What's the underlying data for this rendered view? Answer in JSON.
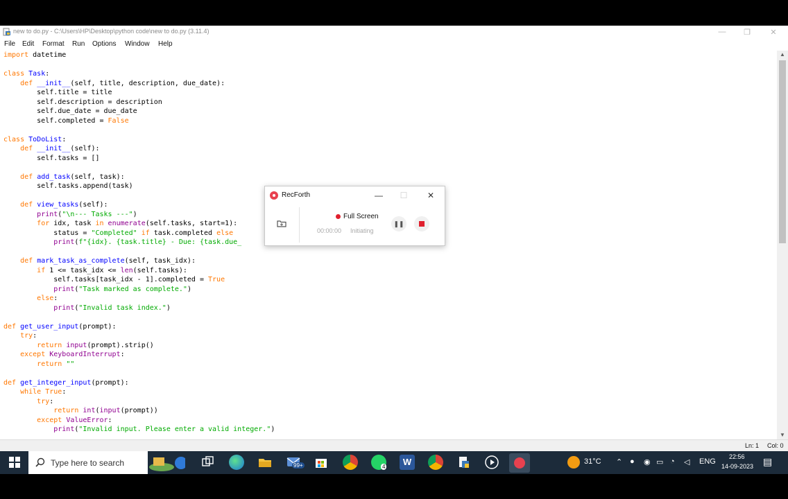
{
  "window": {
    "title": "new to do.py - C:\\Users\\HP\\Desktop\\python code\\new to do.py (3.11.4)",
    "minimize_glyph": "—",
    "maximize_glyph": "❐",
    "close_glyph": "✕"
  },
  "menu": {
    "items": [
      "File",
      "Edit",
      "Format",
      "Run",
      "Options",
      "Window",
      "Help"
    ]
  },
  "status": {
    "line": "Ln: 1",
    "col": "Col: 0"
  },
  "recorder": {
    "app_name": "RecForth",
    "mode": "Full Screen",
    "time": "00:00:00",
    "state": "Initiating",
    "pause_glyph": "❚❚",
    "minimize_glyph": "—",
    "maximize_glyph": "☐",
    "close_glyph": "✕"
  },
  "taskbar": {
    "search_placeholder": "Type here to search",
    "mail_badge": "99+",
    "whatsapp_badge": "4",
    "temperature": "31°C",
    "language": "ENG",
    "clock_time": "22:56",
    "clock_date": "14-09-2023"
  },
  "colors": {
    "keyword": "#ff7700",
    "definition": "#0000ff",
    "builtin": "#900090",
    "string": "#00aa00",
    "taskbar_bg": "#1c2b3a",
    "record_red": "#e0202e"
  },
  "code_lines": [
    [
      {
        "t": "import",
        "c": "kw"
      },
      {
        "t": " datetime"
      }
    ],
    [],
    [
      {
        "t": "class",
        "c": "kw"
      },
      {
        "t": " "
      },
      {
        "t": "Task",
        "c": "def"
      },
      {
        "t": ":"
      }
    ],
    [
      {
        "t": "    "
      },
      {
        "t": "def",
        "c": "kw"
      },
      {
        "t": " "
      },
      {
        "t": "__init__",
        "c": "def"
      },
      {
        "t": "(self, title, description, due_date):"
      }
    ],
    [
      {
        "t": "        self.title = title"
      }
    ],
    [
      {
        "t": "        self.description = description"
      }
    ],
    [
      {
        "t": "        self.due_date = due_date"
      }
    ],
    [
      {
        "t": "        self.completed = "
      },
      {
        "t": "False",
        "c": "kw"
      }
    ],
    [],
    [
      {
        "t": "class",
        "c": "kw"
      },
      {
        "t": " "
      },
      {
        "t": "ToDoList",
        "c": "def"
      },
      {
        "t": ":"
      }
    ],
    [
      {
        "t": "    "
      },
      {
        "t": "def",
        "c": "kw"
      },
      {
        "t": " "
      },
      {
        "t": "__init__",
        "c": "def"
      },
      {
        "t": "(self):"
      }
    ],
    [
      {
        "t": "        self.tasks = []"
      }
    ],
    [],
    [
      {
        "t": "    "
      },
      {
        "t": "def",
        "c": "kw"
      },
      {
        "t": " "
      },
      {
        "t": "add_task",
        "c": "def"
      },
      {
        "t": "(self, task):"
      }
    ],
    [
      {
        "t": "        self.tasks.append(task)"
      }
    ],
    [],
    [
      {
        "t": "    "
      },
      {
        "t": "def",
        "c": "kw"
      },
      {
        "t": " "
      },
      {
        "t": "view_tasks",
        "c": "def"
      },
      {
        "t": "(self):"
      }
    ],
    [
      {
        "t": "        "
      },
      {
        "t": "print",
        "c": "bi"
      },
      {
        "t": "("
      },
      {
        "t": "\"\\n--- Tasks ---\"",
        "c": "str"
      },
      {
        "t": ")"
      }
    ],
    [
      {
        "t": "        "
      },
      {
        "t": "for",
        "c": "kw"
      },
      {
        "t": " idx, task "
      },
      {
        "t": "in",
        "c": "kw"
      },
      {
        "t": " "
      },
      {
        "t": "enumerate",
        "c": "bi"
      },
      {
        "t": "(self.tasks, start=1):"
      }
    ],
    [
      {
        "t": "            status = "
      },
      {
        "t": "\"Completed\"",
        "c": "str"
      },
      {
        "t": " "
      },
      {
        "t": "if",
        "c": "kw"
      },
      {
        "t": " task.completed "
      },
      {
        "t": "else",
        "c": "kw"
      }
    ],
    [
      {
        "t": "            "
      },
      {
        "t": "print",
        "c": "bi"
      },
      {
        "t": "("
      },
      {
        "t": "f\"{idx}. {task.title} - Due: {task.due_",
        "c": "str"
      }
    ],
    [],
    [
      {
        "t": "    "
      },
      {
        "t": "def",
        "c": "kw"
      },
      {
        "t": " "
      },
      {
        "t": "mark_task_as_complete",
        "c": "def"
      },
      {
        "t": "(self, task_idx):"
      }
    ],
    [
      {
        "t": "        "
      },
      {
        "t": "if",
        "c": "kw"
      },
      {
        "t": " 1 <= task_idx <= "
      },
      {
        "t": "len",
        "c": "bi"
      },
      {
        "t": "(self.tasks):"
      }
    ],
    [
      {
        "t": "            self.tasks[task_idx - 1].completed = "
      },
      {
        "t": "True",
        "c": "kw"
      }
    ],
    [
      {
        "t": "            "
      },
      {
        "t": "print",
        "c": "bi"
      },
      {
        "t": "("
      },
      {
        "t": "\"Task marked as complete.\"",
        "c": "str"
      },
      {
        "t": ")"
      }
    ],
    [
      {
        "t": "        "
      },
      {
        "t": "else",
        "c": "kw"
      },
      {
        "t": ":"
      }
    ],
    [
      {
        "t": "            "
      },
      {
        "t": "print",
        "c": "bi"
      },
      {
        "t": "("
      },
      {
        "t": "\"Invalid task index.\"",
        "c": "str"
      },
      {
        "t": ")"
      }
    ],
    [],
    [
      {
        "t": "def",
        "c": "kw"
      },
      {
        "t": " "
      },
      {
        "t": "get_user_input",
        "c": "def"
      },
      {
        "t": "(prompt):"
      }
    ],
    [
      {
        "t": "    "
      },
      {
        "t": "try",
        "c": "kw"
      },
      {
        "t": ":"
      }
    ],
    [
      {
        "t": "        "
      },
      {
        "t": "return",
        "c": "kw"
      },
      {
        "t": " "
      },
      {
        "t": "input",
        "c": "bi"
      },
      {
        "t": "(prompt).strip()"
      }
    ],
    [
      {
        "t": "    "
      },
      {
        "t": "except",
        "c": "kw"
      },
      {
        "t": " "
      },
      {
        "t": "KeyboardInterrupt",
        "c": "bi"
      },
      {
        "t": ":"
      }
    ],
    [
      {
        "t": "        "
      },
      {
        "t": "return",
        "c": "kw"
      },
      {
        "t": " "
      },
      {
        "t": "\"\"",
        "c": "str"
      }
    ],
    [],
    [
      {
        "t": "def",
        "c": "kw"
      },
      {
        "t": " "
      },
      {
        "t": "get_integer_input",
        "c": "def"
      },
      {
        "t": "(prompt):"
      }
    ],
    [
      {
        "t": "    "
      },
      {
        "t": "while",
        "c": "kw"
      },
      {
        "t": " "
      },
      {
        "t": "True",
        "c": "kw"
      },
      {
        "t": ":"
      }
    ],
    [
      {
        "t": "        "
      },
      {
        "t": "try",
        "c": "kw"
      },
      {
        "t": ":"
      }
    ],
    [
      {
        "t": "            "
      },
      {
        "t": "return",
        "c": "kw"
      },
      {
        "t": " "
      },
      {
        "t": "int",
        "c": "bi"
      },
      {
        "t": "("
      },
      {
        "t": "input",
        "c": "bi"
      },
      {
        "t": "(prompt))"
      }
    ],
    [
      {
        "t": "        "
      },
      {
        "t": "except",
        "c": "kw"
      },
      {
        "t": " "
      },
      {
        "t": "ValueError",
        "c": "bi"
      },
      {
        "t": ":"
      }
    ],
    [
      {
        "t": "            "
      },
      {
        "t": "print",
        "c": "bi"
      },
      {
        "t": "("
      },
      {
        "t": "\"Invalid input. Please enter a valid integer.\"",
        "c": "str"
      },
      {
        "t": ")"
      }
    ]
  ]
}
